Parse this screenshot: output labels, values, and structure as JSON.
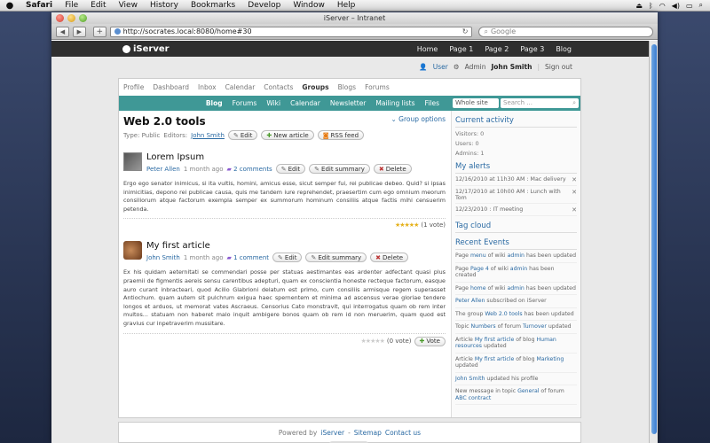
{
  "menubar": {
    "app": "Safari",
    "items": [
      "File",
      "Edit",
      "View",
      "History",
      "Bookmarks",
      "Develop",
      "Window",
      "Help"
    ]
  },
  "browser": {
    "title": "iServer – Intranet",
    "url": "http://socrates.local:8080/home#30",
    "search_placeholder": "Google"
  },
  "site": {
    "logo": "iServer",
    "topnav": [
      "Home",
      "Page 1",
      "Page 2",
      "Page 3",
      "Blog"
    ],
    "userbar": {
      "user": "User",
      "admin": "Admin",
      "name": "John Smith",
      "signout": "Sign out"
    }
  },
  "groupnav": [
    "Profile",
    "Dashboard",
    "Inbox",
    "Calendar",
    "Contacts",
    "Groups",
    "Blogs",
    "Forums"
  ],
  "subnav": {
    "items": [
      "Blog",
      "Forums",
      "Wiki",
      "Calendar",
      "Newsletter",
      "Mailing lists",
      "Files"
    ],
    "scope": "Whole site",
    "search_placeholder": "Search ..."
  },
  "page": {
    "title": "Web 2.0 tools",
    "group_options": "Group options",
    "type": "Type: Public",
    "editors_label": "Editors:",
    "editor": "John Smith",
    "edit": "Edit",
    "new_article": "New article",
    "rss": "RSS feed"
  },
  "articles": [
    {
      "title": "Lorem Ipsum",
      "author": "Peter Allen",
      "age": "1 month ago",
      "comments": "2 comments",
      "edit": "Edit",
      "edit_summary": "Edit summary",
      "delete": "Delete",
      "body": "Ergo ego senator inimicus, si ita vultis, homini, amicus esse, sicut semper fui, rei publicae debeo. Quid? si ipsas inimicitias, depono rei publicae causa, quis me tandem iure reprehendet, praesertim cum ego omnium meorum consiliorum atque factorum exempla semper ex summorum hominum consiliis atque factis mihi censuerim petenda.",
      "rating": 4,
      "votes": "(1 vote)"
    },
    {
      "title": "My first article",
      "author": "John Smith",
      "age": "1 month ago",
      "comments": "1 comment",
      "edit": "Edit",
      "edit_summary": "Edit summary",
      "delete": "Delete",
      "body": "Ex his quidam aeternitati se commendari posse per statuas aestimantes eas ardenter adfectant quasi plus praemii de figmentis aereis sensu carentibus adepturi, quam ex conscientia honeste recteque factorum, easque auro curant inbracteari, quod Acilio Glabrioni delatum est primo, cum consiliis armisque regem superasset Antiochum. quam autem sit pulchrum exigua haec spernentem et minima ad ascensus verae gloriae tendere longos et arduos, ut memorat vates Ascraeus. Censorius Cato monstravit, qui interrogatus quam ob rem inter multos... statuam non haberet malo inquit ambigere bonos quam ob rem id non meruerim, quam quod est gravius cur inpetraverim mussitare.",
      "rating": 0,
      "votes": "(0 vote)",
      "vote": "Vote"
    }
  ],
  "sidebar": {
    "activity_title": "Current activity",
    "visitors": "Visitors: 0",
    "users": "Users: 0",
    "admins": "Admins: 1",
    "alerts_title": "My alerts",
    "alerts": [
      "12/16/2010 at 11h30 AM : Mac delivery",
      "12/17/2010 at 10h00 AM : Lunch with Tom",
      "12/23/2010 : IT meeting"
    ],
    "tagcloud_title": "Tag cloud",
    "events_title": "Recent Events",
    "events": [
      [
        "Page ",
        "menu",
        " of wiki ",
        "admin",
        " has been updated"
      ],
      [
        "Page ",
        "Page 4",
        " of wiki ",
        "admin",
        " has been created"
      ],
      [
        "Page ",
        "home",
        " of wiki ",
        "admin",
        " has been updated"
      ],
      [
        "",
        "Peter Allen",
        " subscribed on iServer",
        "",
        ""
      ],
      [
        "The group ",
        "Web 2.0 tools",
        " has been updated",
        "",
        ""
      ],
      [
        "Topic ",
        "Numbers",
        " of forum ",
        "Turnover",
        " updated"
      ],
      [
        "Article ",
        "My first article",
        " of blog ",
        "Human resources",
        " updated"
      ],
      [
        "Article ",
        "My first article",
        " of blog ",
        "Marketing",
        " updated"
      ],
      [
        "",
        "John Smith",
        " updated his profile",
        "",
        ""
      ],
      [
        "New message in topic ",
        "General",
        " of forum ",
        "ABC contract",
        ""
      ]
    ]
  },
  "footer": {
    "powered": "Powered by",
    "brand": "iServer",
    "sitemap": "Sitemap",
    "contact": "Contact us"
  }
}
